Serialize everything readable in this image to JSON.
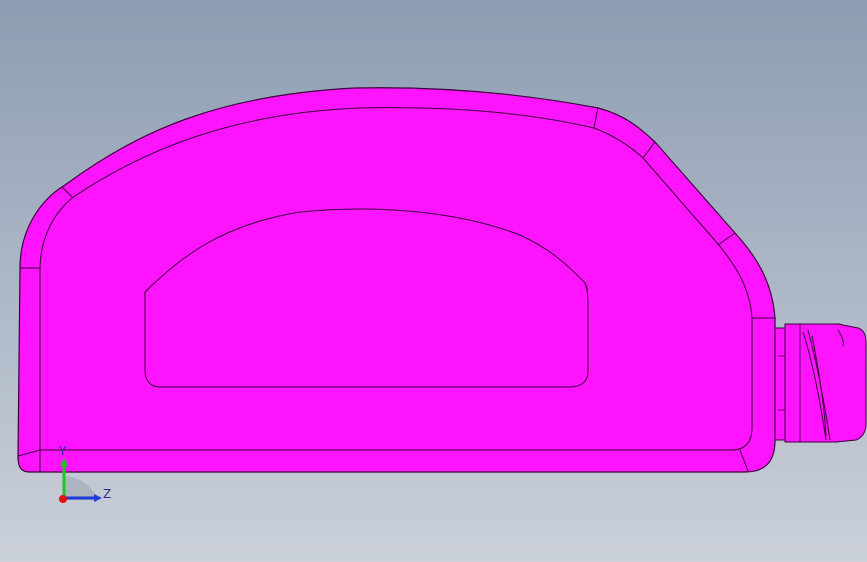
{
  "viewport": {
    "background_top": "#8d9db3",
    "background_bottom": "#cbd0d9"
  },
  "model": {
    "color": "#ff14ff",
    "edge_color": "#3a003a"
  },
  "triad": {
    "y_label": "Y",
    "z_label": "Z",
    "y_color": "#1ec81e",
    "z_color": "#1e3cdc",
    "x_color": "#e01010"
  }
}
